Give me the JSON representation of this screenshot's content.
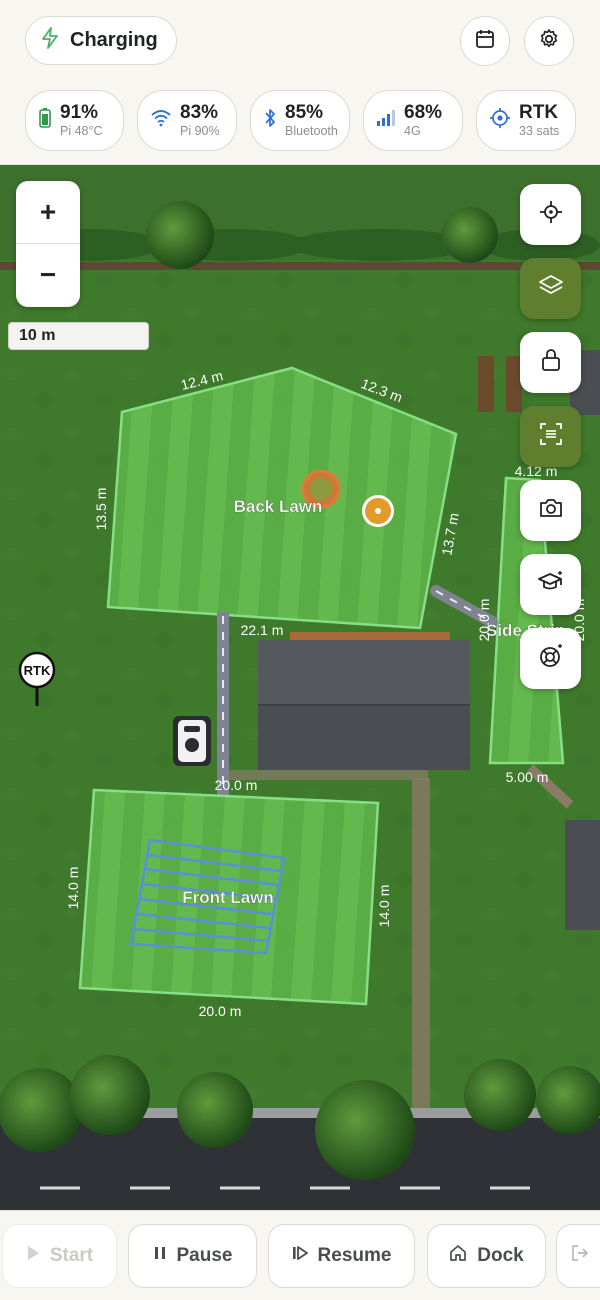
{
  "status": {
    "label": "Charging"
  },
  "stats": [
    {
      "value": "91%",
      "sub": "Pi 48°C",
      "icon": "battery-icon"
    },
    {
      "value": "83%",
      "sub": "Pi 90%",
      "icon": "wifi-icon"
    },
    {
      "value": "85%",
      "sub": "Bluetooth",
      "icon": "bluetooth-icon"
    },
    {
      "value": "68%",
      "sub": "4G",
      "icon": "cellular-signal-icon"
    },
    {
      "value": "RTK",
      "sub": "33 sats",
      "icon": "gps-target-icon"
    }
  ],
  "map": {
    "zoom_in": "+",
    "zoom_out": "−",
    "scale": "10 m",
    "rtk_marker": "RTK",
    "zones": {
      "back_lawn": {
        "name": "Back Lawn",
        "edges": [
          "12.4 m",
          "12.3 m",
          "13.5 m",
          "13.7 m",
          "22.1 m"
        ]
      },
      "front_lawn": {
        "name": "Front Lawn",
        "edges": [
          "20.0 m",
          "14.0 m",
          "14.0 m",
          "20.0 m"
        ]
      },
      "side_strip": {
        "name": "Side Strip",
        "edges": [
          "4.12 m",
          "20.0 m",
          "20.0 m",
          "5.00 m"
        ]
      }
    }
  },
  "controls": [
    {
      "label": "Start",
      "icon": "play-icon",
      "disabled": true
    },
    {
      "label": "Pause",
      "icon": "pause-icon",
      "disabled": false
    },
    {
      "label": "Resume",
      "icon": "resume-icon",
      "disabled": false
    },
    {
      "label": "Dock",
      "icon": "home-icon",
      "disabled": false
    }
  ],
  "colors": {
    "accent": "#5f7f2f",
    "zone_outline": "#7fe08a",
    "lawn": "#4f8a34"
  }
}
